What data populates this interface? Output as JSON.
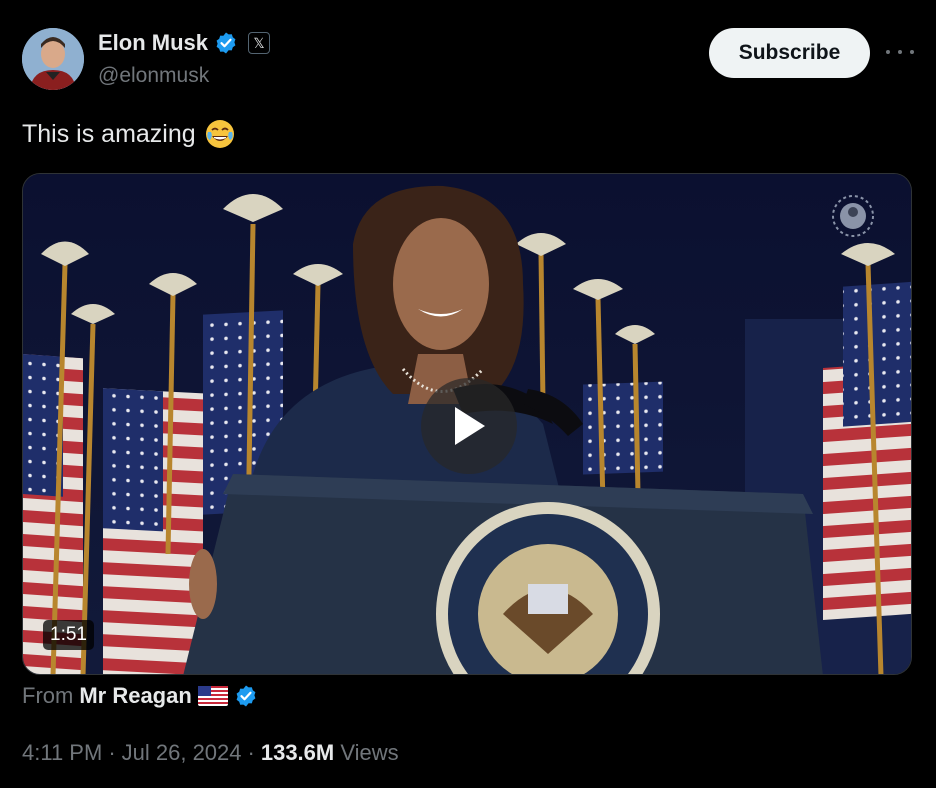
{
  "author": {
    "display_name": "Elon Musk",
    "handle": "@elonmusk",
    "affiliation_badge": "𝕏",
    "avatar_icon": "avatar-photo"
  },
  "actions": {
    "subscribe_label": "Subscribe"
  },
  "tweet": {
    "text": "This is amazing",
    "emoji": "😂"
  },
  "media": {
    "duration": "1:51",
    "play_icon": "play-icon"
  },
  "source": {
    "prefix": "From",
    "name": "Mr Reagan",
    "flag": "🇺🇸"
  },
  "meta": {
    "time": "4:11 PM",
    "sep1": "·",
    "date": "Jul 26, 2024",
    "sep2": "·",
    "views_count": "133.6M",
    "views_label": "Views"
  },
  "colors": {
    "verified_blue": "#1d9bf0",
    "background": "#000000",
    "subscribe_bg": "#eff3f4"
  }
}
